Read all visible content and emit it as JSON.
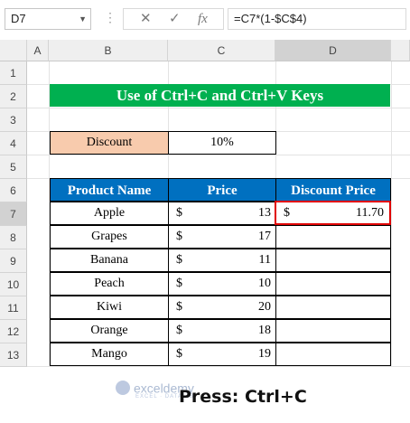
{
  "formula_bar": {
    "name_box": "D7",
    "dots": "⋮",
    "cancel_icon": "✕",
    "enter_icon": "✓",
    "fx_label": "fx",
    "formula": "=C7*(1-$C$4)"
  },
  "columns": [
    "A",
    "B",
    "C",
    "D"
  ],
  "rows": [
    "1",
    "2",
    "3",
    "4",
    "5",
    "6",
    "7",
    "8",
    "9",
    "10",
    "11",
    "12",
    "13"
  ],
  "title": "Use of Ctrl+C and Ctrl+V Keys",
  "discount": {
    "label": "Discount",
    "value": "10%"
  },
  "table": {
    "headers": [
      "Product Name",
      "Price",
      "Discount Price"
    ],
    "currency": "$",
    "rows": [
      {
        "name": "Apple",
        "price": "13",
        "discount_price": "11.70"
      },
      {
        "name": "Grapes",
        "price": "17",
        "discount_price": ""
      },
      {
        "name": "Banana",
        "price": "11",
        "discount_price": ""
      },
      {
        "name": "Peach",
        "price": "10",
        "discount_price": ""
      },
      {
        "name": "Kiwi",
        "price": "20",
        "discount_price": ""
      },
      {
        "name": "Orange",
        "price": "18",
        "discount_price": ""
      },
      {
        "name": "Mango",
        "price": "19",
        "discount_price": ""
      }
    ]
  },
  "watermark": {
    "name": "exceldemy",
    "tagline": "EXCEL · DATA · BI"
  },
  "caption": "Press: Ctrl+C",
  "colors": {
    "title_bg": "#00b050",
    "header_bg": "#0070c0",
    "discount_bg": "#f8cbad",
    "selection": "#e00000"
  }
}
